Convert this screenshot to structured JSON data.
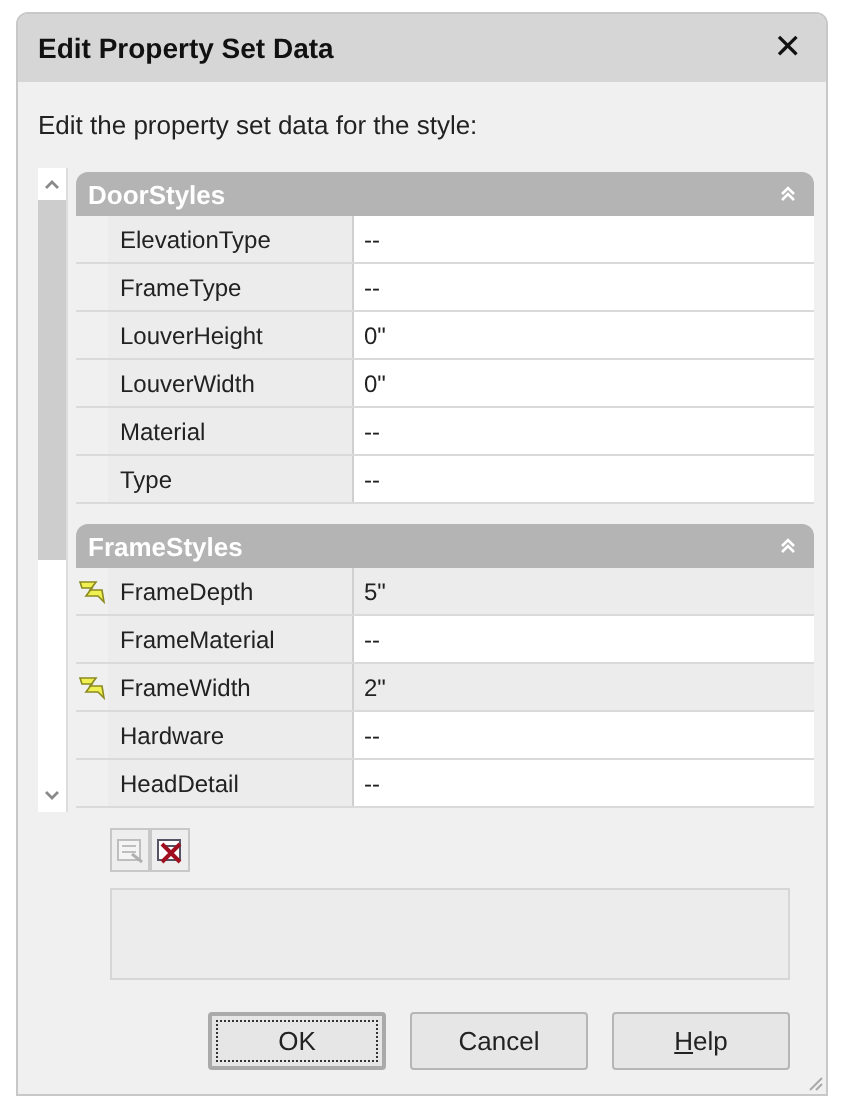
{
  "window": {
    "title": "Edit Property Set Data",
    "close": "✕"
  },
  "instruction": "Edit the property set data for the style:",
  "sections": [
    {
      "name": "DoorStyles",
      "expanded": true,
      "rows": [
        {
          "name": "ElevationType",
          "value": "--",
          "overridden": false
        },
        {
          "name": "FrameType",
          "value": "--",
          "overridden": false
        },
        {
          "name": "LouverHeight",
          "value": "0\"",
          "overridden": false
        },
        {
          "name": "LouverWidth",
          "value": "0\"",
          "overridden": false
        },
        {
          "name": "Material",
          "value": "--",
          "overridden": false
        },
        {
          "name": "Type",
          "value": "--",
          "overridden": false
        }
      ]
    },
    {
      "name": "FrameStyles",
      "expanded": true,
      "rows": [
        {
          "name": "FrameDepth",
          "value": "5\"",
          "overridden": true
        },
        {
          "name": "FrameMaterial",
          "value": "--",
          "overridden": false
        },
        {
          "name": "FrameWidth",
          "value": "2\"",
          "overridden": true
        },
        {
          "name": "Hardware",
          "value": "--",
          "overridden": false
        },
        {
          "name": "HeadDetail",
          "value": "--",
          "overridden": false
        }
      ]
    }
  ],
  "toolbar": [
    {
      "kind": "add",
      "disabled": true
    },
    {
      "kind": "remove",
      "disabled": false
    }
  ],
  "buttons": [
    {
      "label": "OK",
      "default": true,
      "underline_first": false
    },
    {
      "label": "Cancel",
      "default": false,
      "underline_first": false
    },
    {
      "label": "Help",
      "default": false,
      "underline_first": true
    }
  ]
}
